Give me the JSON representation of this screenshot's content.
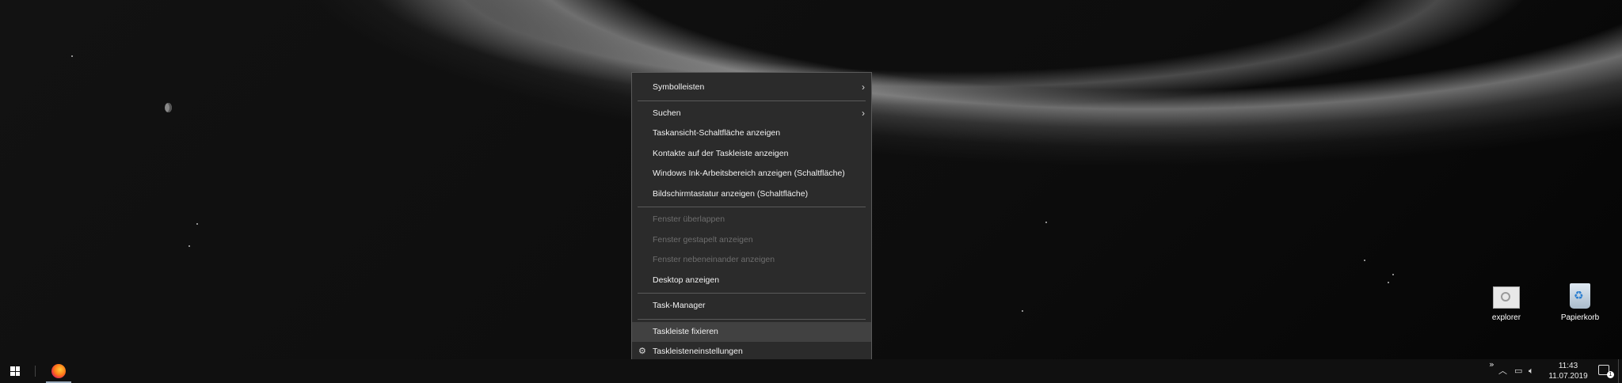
{
  "context_menu": {
    "items": [
      {
        "label": "Symbolleisten",
        "submenu": true,
        "disabled": false
      },
      {
        "label": "Suchen",
        "submenu": true,
        "disabled": false
      },
      {
        "label": "Taskansicht-Schaltfläche anzeigen",
        "disabled": false
      },
      {
        "label": "Kontakte auf der Taskleiste anzeigen",
        "disabled": false
      },
      {
        "label": "Windows Ink-Arbeitsbereich anzeigen (Schaltfläche)",
        "disabled": false
      },
      {
        "label": "Bildschirmtastatur anzeigen (Schaltfläche)",
        "disabled": false
      },
      {
        "label": "Fenster überlappen",
        "disabled": true
      },
      {
        "label": "Fenster gestapelt anzeigen",
        "disabled": true
      },
      {
        "label": "Fenster nebeneinander anzeigen",
        "disabled": true
      },
      {
        "label": "Desktop anzeigen",
        "disabled": false
      },
      {
        "label": "Task-Manager",
        "disabled": false
      },
      {
        "label": "Taskleiste fixieren",
        "disabled": false,
        "highlighted": true
      },
      {
        "label": "Taskleisteneinstellungen",
        "disabled": false,
        "icon": "gear-icon"
      }
    ]
  },
  "desktop_icons": {
    "explorer": {
      "label": "explorer",
      "icon": "explorer-icon"
    },
    "recycle_bin": {
      "label": "Papierkorb",
      "icon": "recycle-bin-icon"
    }
  },
  "taskbar": {
    "start_icon": "windows-logo-icon",
    "pinned": [
      {
        "name": "firefox",
        "icon": "firefox-icon",
        "active": true
      }
    ],
    "tray": {
      "overflow_glyph": "»",
      "chevron_glyph": "︿",
      "clock_time": "11:43",
      "clock_date": "11.07.2019",
      "notification_count": "1"
    }
  },
  "colors": {
    "menu_bg": "#2b2b2b",
    "menu_border": "#5a5a5a",
    "menu_highlight": "#414141",
    "disabled_text": "#6d6d6d",
    "taskbar_bg": "#101010"
  }
}
